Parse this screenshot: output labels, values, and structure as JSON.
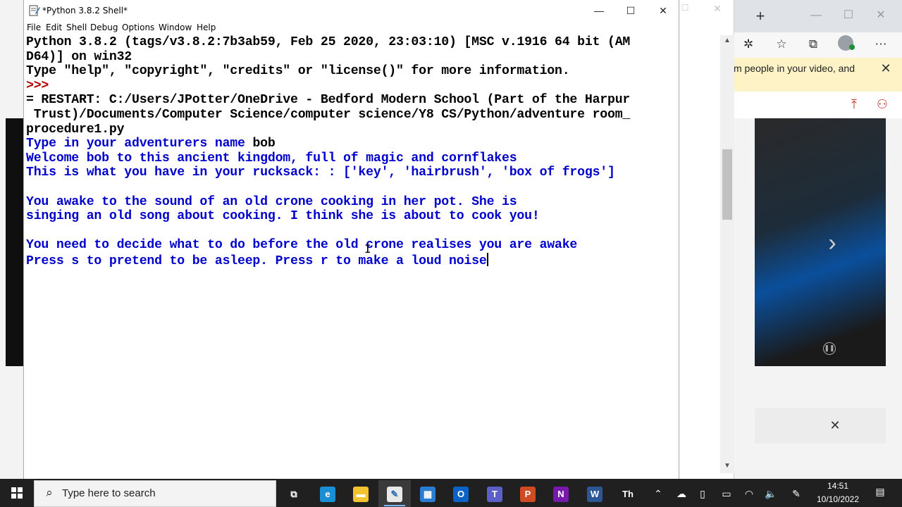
{
  "idle": {
    "title": "*Python 3.8.2 Shell*",
    "menu": [
      "File",
      "Edit",
      "Shell",
      "Debug",
      "Options",
      "Window",
      "Help"
    ],
    "shell": {
      "lines": [
        {
          "segments": [
            {
              "text": "Python 3.8.2 (tags/v3.8.2:7b3ab59, Feb 25 2020, 23:03:10) [MSC v.1916 64 bit (AM",
              "kind": "input"
            }
          ]
        },
        {
          "segments": [
            {
              "text": "D64)] on win32",
              "kind": "input"
            }
          ]
        },
        {
          "segments": [
            {
              "text": "Type \"help\", \"copyright\", \"credits\" or \"license()\" for more information.",
              "kind": "input"
            }
          ]
        },
        {
          "segments": [
            {
              "text": ">>> ",
              "kind": "prompt"
            }
          ]
        },
        {
          "segments": [
            {
              "text": "= RESTART: C:/Users/JPotter/OneDrive - Bedford Modern School (Part of the Harpur",
              "kind": "input"
            }
          ]
        },
        {
          "segments": [
            {
              "text": " Trust)/Documents/Computer Science/computer science/Y8 CS/Python/adventure room_",
              "kind": "input"
            }
          ]
        },
        {
          "segments": [
            {
              "text": "procedure1.py",
              "kind": "input"
            }
          ]
        },
        {
          "segments": [
            {
              "text": "Type in your adventurers name ",
              "kind": "out"
            },
            {
              "text": "bob",
              "kind": "input"
            }
          ]
        },
        {
          "segments": [
            {
              "text": "Welcome bob to this ancient kingdom, full of magic and cornflakes",
              "kind": "out"
            }
          ]
        },
        {
          "segments": [
            {
              "text": "This is what you have in your rucksack: : ['key', 'hairbrush', 'box of frogs']",
              "kind": "out"
            }
          ]
        },
        {
          "segments": [
            {
              "text": "",
              "kind": "out"
            }
          ]
        },
        {
          "segments": [
            {
              "text": "You awake to the sound of an old crone cooking in her pot. She is",
              "kind": "out"
            }
          ]
        },
        {
          "segments": [
            {
              "text": "singing an old song about cooking. I think she is about to cook you!",
              "kind": "out"
            }
          ]
        },
        {
          "segments": [
            {
              "text": "",
              "kind": "out"
            }
          ]
        },
        {
          "segments": [
            {
              "text": "You need to decide what to do before the old crone realises you are awake",
              "kind": "out"
            }
          ]
        },
        {
          "segments": [
            {
              "text": "Press s to pretend to be asleep. Press r to make a loud noise",
              "kind": "out"
            }
          ],
          "cursor": true
        }
      ]
    }
  },
  "browser": {
    "notice_text": "m people in your video, and"
  },
  "taskbar": {
    "search_placeholder": "Type here to search",
    "time": "14:51",
    "date": "10/10/2022",
    "apps": [
      {
        "name": "task-view",
        "glyph": "⧉"
      },
      {
        "name": "edge",
        "glyph": "e",
        "color": "#1a8fd6"
      },
      {
        "name": "file-explorer",
        "glyph": "▬",
        "color": "#f4c430"
      },
      {
        "name": "idle",
        "glyph": "✎",
        "color": "#e8e8e8",
        "active": true
      },
      {
        "name": "store",
        "glyph": "▦",
        "color": "#2b7cd3"
      },
      {
        "name": "outlook",
        "glyph": "O",
        "color": "#0a64c8"
      },
      {
        "name": "teams",
        "glyph": "T",
        "color": "#5b5fc7"
      },
      {
        "name": "powerpoint",
        "glyph": "P",
        "color": "#d04a23"
      },
      {
        "name": "onenote",
        "glyph": "N",
        "color": "#7719aa"
      },
      {
        "name": "word",
        "glyph": "W",
        "color": "#2b5797"
      },
      {
        "name": "immersive-reader",
        "glyph": "Th",
        "color": "#202020"
      }
    ]
  },
  "colors": {
    "prompt": "#b00000",
    "output": "#0000cc",
    "taskbar": "#202020"
  }
}
